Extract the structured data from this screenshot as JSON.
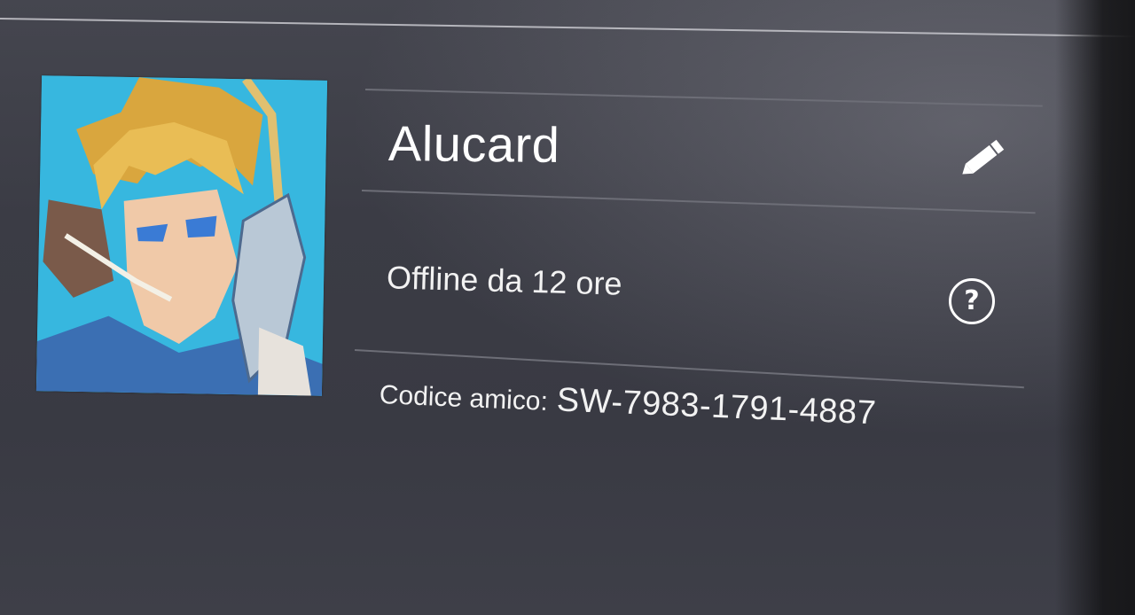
{
  "profile": {
    "username": "Alucard",
    "status": "Offline da 12 ore",
    "friend_code_label": "Codice amico:",
    "friend_code": "SW-7983-1791-4887"
  },
  "icons": {
    "edit": "pencil-icon",
    "help": "question-mark-circle-icon",
    "help_glyph": "?"
  },
  "colors": {
    "background": "#3b3c45",
    "text": "#ffffff",
    "divider": "#6d6e77",
    "avatar_bg": "#35b8e0"
  }
}
